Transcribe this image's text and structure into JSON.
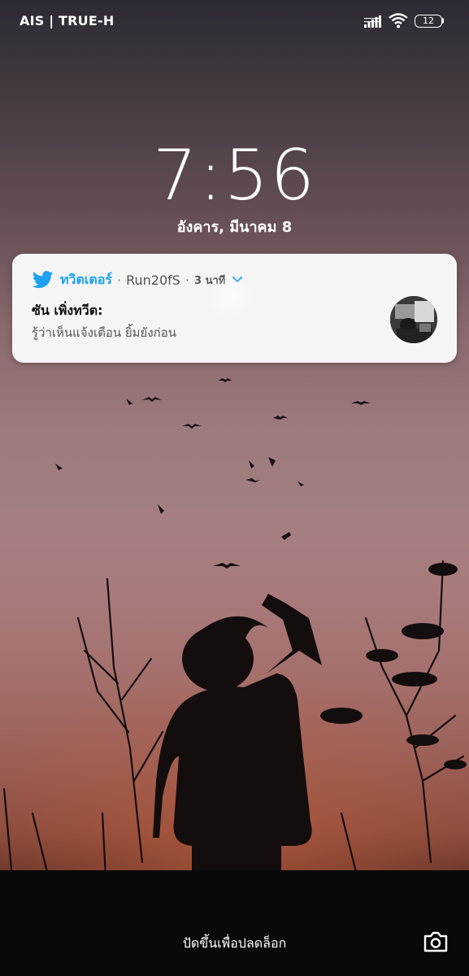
{
  "status_bar": {
    "carrier": "AIS | TRUE-H",
    "battery": "12",
    "icons": [
      "signal-icon",
      "wifi-icon",
      "battery-icon"
    ]
  },
  "lockscreen": {
    "time": "7:56",
    "date": "อังคาร, มีนาคม 8",
    "unlock_hint": "ปัดขึ้นเพื่อปลดล็อก"
  },
  "notification": {
    "app_name": "ทวิตเตอร์",
    "account": "Run20fS",
    "time": "3 นาที",
    "title": "ซัน เพิ่งทวีต:",
    "body": "รู้ว่าเห็นแจ้งเตือน ยิ้มยังก่อน",
    "icon": "twitter-bird-icon",
    "accent_color": "#1da1f2"
  },
  "colors": {
    "notification_bg": "#f5f5f5"
  }
}
